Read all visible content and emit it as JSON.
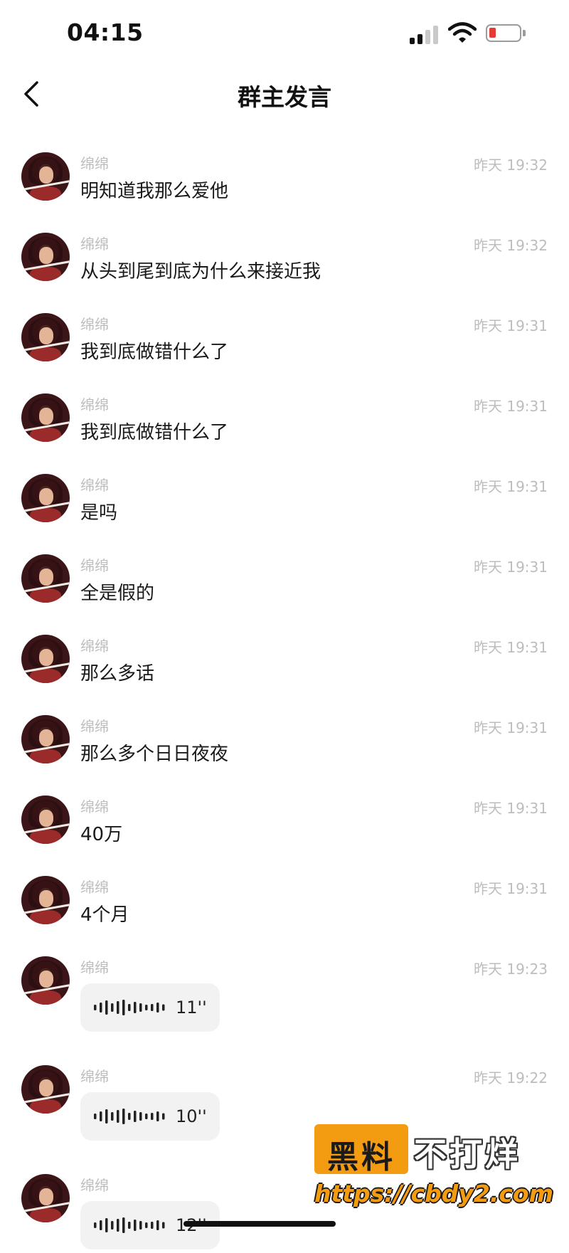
{
  "status_bar": {
    "time": "04:15",
    "battery_color": "#e53b35"
  },
  "nav": {
    "title": "群主发言",
    "back_icon": "chevron-left-icon"
  },
  "messages": [
    {
      "sender": "绵绵",
      "time": "昨天 19:32",
      "type": "text",
      "text": "明知道我那么爱他"
    },
    {
      "sender": "绵绵",
      "time": "昨天 19:32",
      "type": "text",
      "text": "从头到尾到底为什么来接近我"
    },
    {
      "sender": "绵绵",
      "time": "昨天 19:31",
      "type": "text",
      "text": "我到底做错什么了"
    },
    {
      "sender": "绵绵",
      "time": "昨天 19:31",
      "type": "text",
      "text": "我到底做错什么了"
    },
    {
      "sender": "绵绵",
      "time": "昨天 19:31",
      "type": "text",
      "text": "是吗"
    },
    {
      "sender": "绵绵",
      "time": "昨天 19:31",
      "type": "text",
      "text": "全是假的"
    },
    {
      "sender": "绵绵",
      "time": "昨天 19:31",
      "type": "text",
      "text": "那么多话"
    },
    {
      "sender": "绵绵",
      "time": "昨天 19:31",
      "type": "text",
      "text": "那么多个日日夜夜"
    },
    {
      "sender": "绵绵",
      "time": "昨天 19:31",
      "type": "text",
      "text": "40万"
    },
    {
      "sender": "绵绵",
      "time": "昨天 19:31",
      "type": "text",
      "text": "4个月"
    },
    {
      "sender": "绵绵",
      "time": "昨天 19:23",
      "type": "voice",
      "duration": "11''"
    },
    {
      "sender": "绵绵",
      "time": "昨天 19:22",
      "type": "voice",
      "duration": "10''"
    },
    {
      "sender": "绵绵",
      "time": "",
      "type": "voice",
      "duration": "12''"
    }
  ],
  "watermark": {
    "box_text": "黑料",
    "side_text": "不打烊",
    "url": "https://cbdy2.com",
    "accent_color": "#f39c12"
  }
}
